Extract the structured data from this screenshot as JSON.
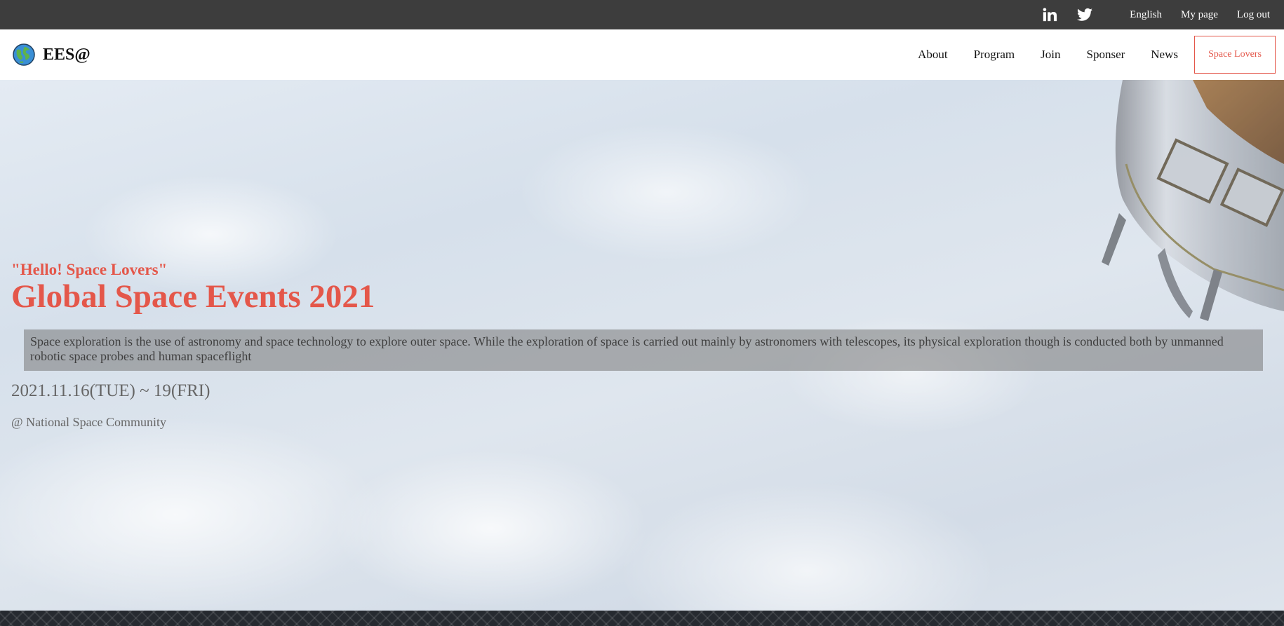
{
  "topbar": {
    "social_icons": [
      "linkedin-icon",
      "twitter-icon"
    ],
    "links": [
      "English",
      "My page",
      "Log out"
    ]
  },
  "header": {
    "brand": "EES@",
    "logo_icon": "globe-icon",
    "nav": [
      "About",
      "Program",
      "Join",
      "Sponser",
      "News"
    ],
    "cta": "Space Lovers"
  },
  "hero": {
    "tagline": "\"Hello! Space Lovers\"",
    "title": "Global Space Events 2021",
    "description": "Space exploration is the use of astronomy and space technology to explore outer space. While the exploration of space is carried out mainly by astronomers with telescopes, its physical exploration though is conducted both by unmanned robotic space probes and human spaceflight",
    "dates": "2021.11.16(TUE) ~ 19(FRI)",
    "venue": "@ National Space Community"
  },
  "colors": {
    "accent": "#e4574a",
    "topbar_bg": "#3d3d3d",
    "footer_bg": "#262a30"
  }
}
